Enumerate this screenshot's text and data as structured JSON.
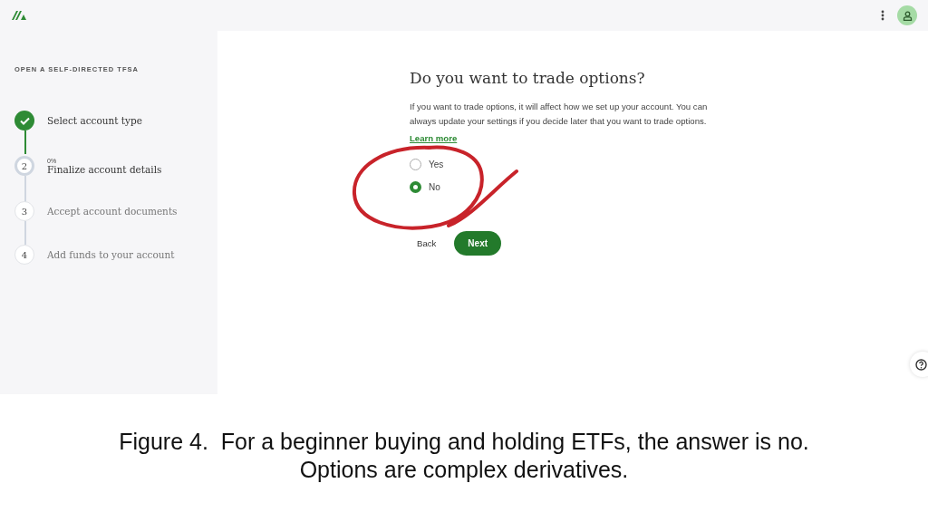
{
  "sidebar": {
    "title": "OPEN A SELF-DIRECTED TFSA",
    "steps": [
      {
        "kind": "done",
        "label": "Select account type"
      },
      {
        "kind": "current",
        "number": "2",
        "progress": "0%",
        "label": "Finalize account details"
      },
      {
        "kind": "upcoming",
        "number": "3",
        "label": "Accept account documents"
      },
      {
        "kind": "upcoming",
        "number": "4",
        "label": "Add funds to your account"
      }
    ]
  },
  "question": {
    "title": "Do you want to trade options?",
    "description": "If you want to trade options, it will affect how we set up your account. You can always update your settings if you decide later that you want to trade options.",
    "link": "Learn more",
    "options": [
      {
        "label": "Yes",
        "selected": false
      },
      {
        "label": "No",
        "selected": true
      }
    ],
    "back_button": "Back",
    "next_button": "Next"
  },
  "caption": [
    "Figure 4.  For a beginner buying and holding ETFs, the answer is no.",
    "Options are complex derivatives."
  ]
}
